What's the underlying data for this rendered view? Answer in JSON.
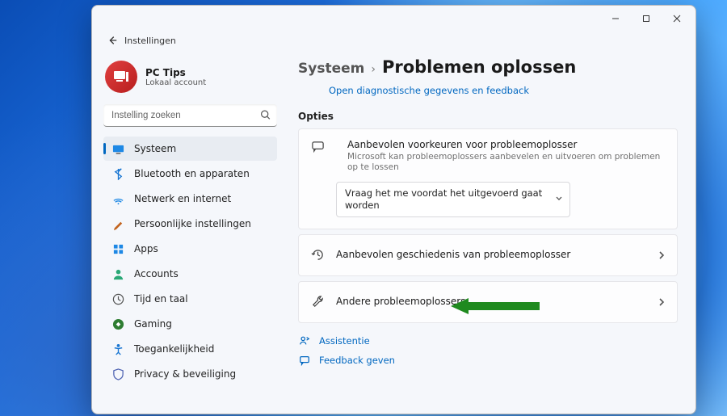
{
  "window": {
    "app_name": "Instellingen"
  },
  "profile": {
    "name": "PC Tips",
    "subtitle": "Lokaal account"
  },
  "search": {
    "placeholder": "Instelling zoeken"
  },
  "sidebar": {
    "items": [
      {
        "label": "Systeem"
      },
      {
        "label": "Bluetooth en apparaten"
      },
      {
        "label": "Netwerk en internet"
      },
      {
        "label": "Persoonlijke instellingen"
      },
      {
        "label": "Apps"
      },
      {
        "label": "Accounts"
      },
      {
        "label": "Tijd en taal"
      },
      {
        "label": "Gaming"
      },
      {
        "label": "Toegankelijkheid"
      },
      {
        "label": "Privacy & beveiliging"
      }
    ]
  },
  "breadcrumb": {
    "parent": "Systeem",
    "current": "Problemen oplossen"
  },
  "diag_link": "Open diagnostische gegevens en feedback",
  "section": "Opties",
  "pref": {
    "title": "Aanbevolen voorkeuren voor probleemoplosser",
    "subtitle": "Microsoft kan probleemoplossers aanbevelen en uitvoeren om problemen op te lossen",
    "selected": "Vraag het me voordat het uitgevoerd gaat worden"
  },
  "rows": [
    {
      "title": "Aanbevolen geschiedenis van probleemoplosser"
    },
    {
      "title": "Andere probleemoplossers"
    }
  ],
  "footer": {
    "help": "Assistentie",
    "feedback": "Feedback geven"
  }
}
